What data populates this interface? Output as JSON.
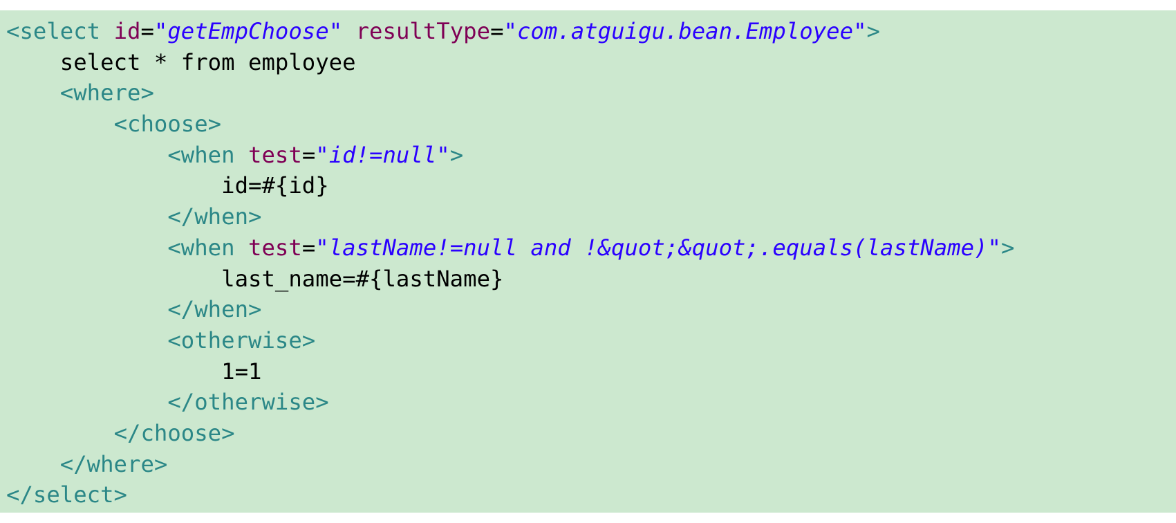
{
  "code": {
    "select_open": "<select",
    "attr_id": "id",
    "eq": "=",
    "val_id": "\"getEmpChoose\"",
    "attr_result_type": "resultType",
    "val_result_type": "\"com.atguigu.bean.Employee\"",
    "close_bracket": ">",
    "sql_select": "select * from employee",
    "where_open": "<where>",
    "choose_open": "<choose>",
    "when_open": "<when",
    "attr_test": "test",
    "val_test_1": "\"id!=null\"",
    "body_1": "id=#{id}",
    "when_close": "</when>",
    "val_test_2": "\"lastName!=null and !&quot;&quot;.equals(lastName)\"",
    "body_2": "last_name=#{lastName}",
    "otherwise_open": "<otherwise>",
    "body_3": "1=1",
    "otherwise_close": "</otherwise>",
    "choose_close": "</choose>",
    "where_close": "</where>",
    "select_close": "</select>"
  }
}
